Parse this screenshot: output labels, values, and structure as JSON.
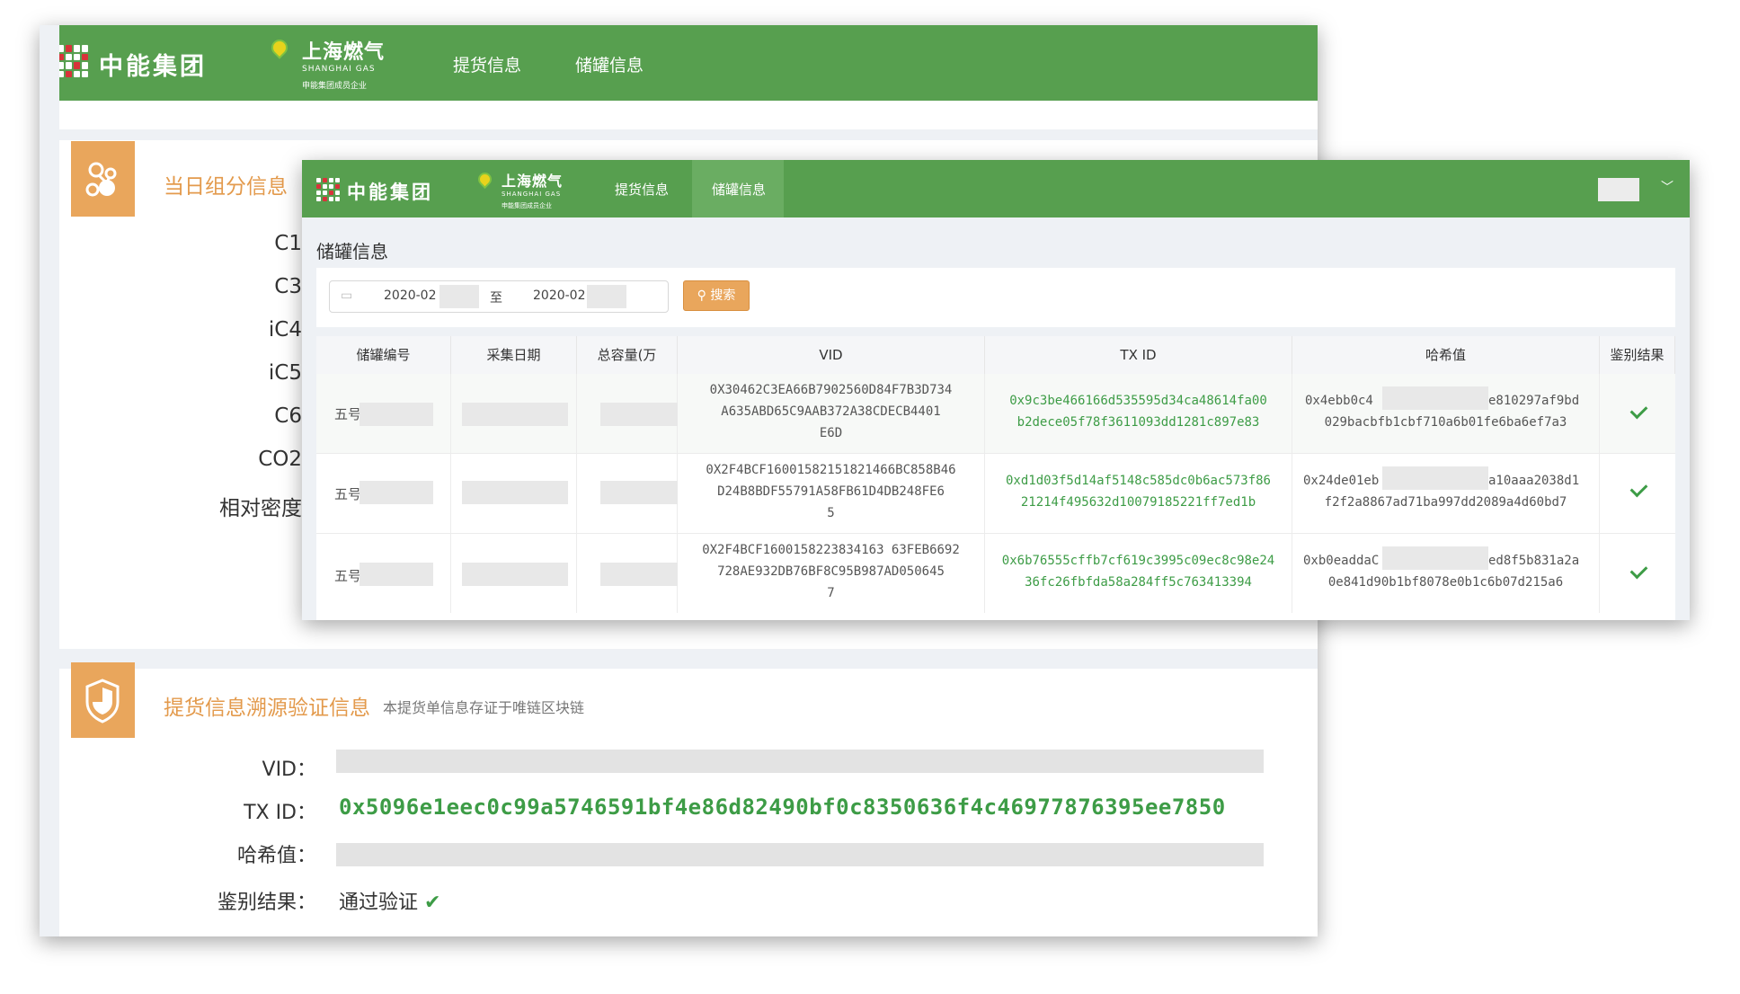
{
  "brand": {
    "group_name": "中能集团",
    "gas_name": "上海燃气",
    "gas_en": "SHANGHAI GAS",
    "gas_sub": "申能集团成员企业"
  },
  "back_nav": {
    "items": [
      "提货信息",
      "储罐信息"
    ]
  },
  "composition": {
    "title": "当日组分信息",
    "labels": [
      "C1",
      "C3",
      "iC4",
      "iC5",
      "C6",
      "CO2",
      "相对密度"
    ]
  },
  "verify": {
    "title": "提货信息溯源验证信息",
    "subtitle": "本提货单信息存证于唯链区块链",
    "vid_label": "VID：",
    "txid_label": "TX ID：",
    "txid_value": "0x5096e1eec0c99a5746591bf4e86d82490bf0c8350636f4c46977876395ee7850",
    "hash_label": "哈希值：",
    "result_label": "鉴别结果：",
    "result_value": "通过验证"
  },
  "front_nav": {
    "items": [
      "提货信息",
      "储罐信息"
    ],
    "active": "储罐信息"
  },
  "tank": {
    "page_title": "储罐信息",
    "date_from": "2020-02",
    "date_sep": "至",
    "date_to": "2020-02",
    "search_label": "搜索",
    "columns": [
      "储罐编号",
      "采集日期",
      "总容量(万",
      "VID",
      "TX ID",
      "哈希值",
      "鉴别结果"
    ],
    "rows": [
      {
        "tank_prefix": "五号",
        "vid": [
          "0X30462C3EA66B7902560D84F7B3D734",
          "A635ABD65C9AAB372A38CDECB4401",
          "E6D"
        ],
        "txid": [
          "0x9c3be466166d535595d34ca48614fa00",
          "b2dece05f78f3611093dd1281c897e83"
        ],
        "hash_a": "0x4ebb0c4",
        "hash_b": "e810297af9bd",
        "hash_c": "029bacbfb1cbf710a6b01fe6ba6ef7a3"
      },
      {
        "tank_prefix": "五号",
        "vid": [
          "0X2F4BCF16001582151821466BC858B46",
          "D24B8BDF55791A58FB61D4DB248FE6",
          "5"
        ],
        "txid": [
          "0xd1d03f5d14af5148c585dc0b6ac573f86",
          "21214f495632d10079185221ff7ed1b"
        ],
        "hash_a": "0x24de01eb",
        "hash_b": "a10aaa2038d1",
        "hash_c": "f2f2a8867ad71ba997dd2089a4d60bd7"
      },
      {
        "tank_prefix": "五号",
        "vid": [
          "0X2F4BCF1600158223834163 63FEB6692",
          "728AE932DB76BF8C95B987AD050645",
          "7"
        ],
        "txid": [
          "0x6b76555cffb7cf619c3995c09ec8c98e24",
          "36fc26fbfda58a284ff5c763413394"
        ],
        "hash_a": "0xb0eaddaC",
        "hash_b": "ed8f5b831a2a",
        "hash_c": "0e841d90b1bf8078e0b1c6b07d215a6"
      }
    ]
  },
  "colors": {
    "nav_green": "#579f4f",
    "accent_orange": "#e9a65c",
    "txid_green": "#3d9c46"
  }
}
